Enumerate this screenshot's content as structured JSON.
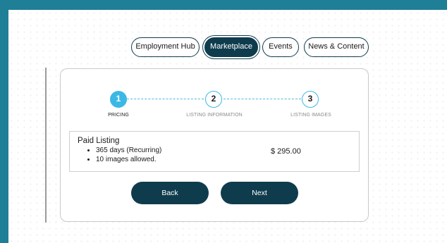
{
  "nav": {
    "items": [
      {
        "label": "Employment Hub",
        "active": false
      },
      {
        "label": "Marketplace",
        "active": true
      },
      {
        "label": "Events",
        "active": false
      },
      {
        "label": "News & Content",
        "active": false
      }
    ]
  },
  "stepper": {
    "steps": [
      {
        "number": "1",
        "label": "PRICING",
        "state": "active"
      },
      {
        "number": "2",
        "label": "LISTING INFORMATION",
        "state": "todo"
      },
      {
        "number": "3",
        "label": "LISTING IMAGES",
        "state": "todo"
      }
    ]
  },
  "listing": {
    "title": "Paid Listing",
    "features": [
      "365 days (Recurring)",
      "10 images allowed."
    ],
    "price": "$ 295.00"
  },
  "actions": {
    "back_label": "Back",
    "next_label": "Next"
  },
  "colors": {
    "brand": "#1f7f96",
    "dark_teal": "#0f3c4d",
    "step_accent": "#3cb8e6"
  }
}
